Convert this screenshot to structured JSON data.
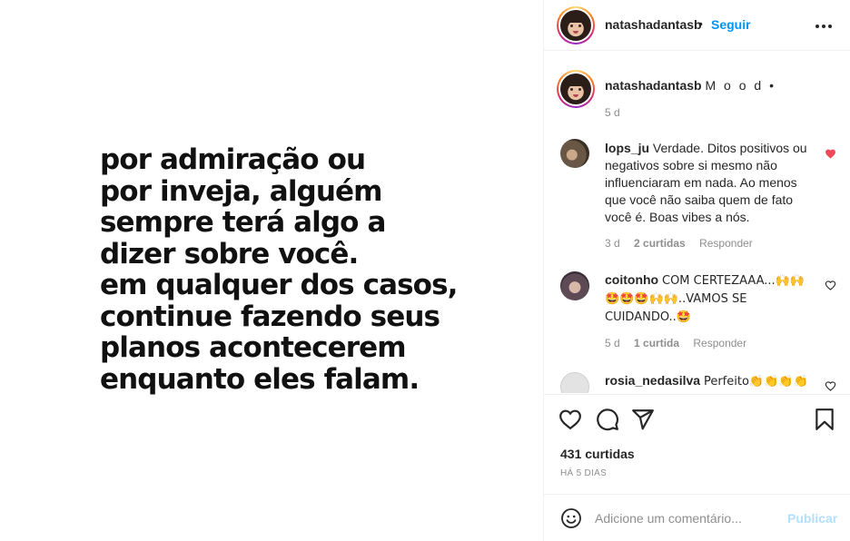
{
  "post": {
    "quote_lines": [
      "por admiração ou",
      "por inveja, alguém",
      "sempre terá algo a",
      "dizer sobre você.",
      "em qualquer dos casos,",
      "continue fazendo seus",
      "planos acontecerem",
      "enquanto eles falam."
    ]
  },
  "header": {
    "username": "natashadantasb",
    "separator": "•",
    "follow_label": "Seguir",
    "more_icon": "more-horizontal-icon"
  },
  "caption": {
    "username": "natashadantasb",
    "text": "M o o d •",
    "time": "5 d"
  },
  "comments": [
    {
      "username": "lops_ju",
      "text": "Verdade. Ditos positivos ou negativos sobre si mesmo não influenciaram em nada. Ao menos que você não saiba quem de fato você é. Boas vibes a nós.",
      "time": "3 d",
      "likes": "2 curtidas",
      "reply": "Responder",
      "liked": true
    },
    {
      "username": "coitonho",
      "text": "COM CERTEZAAA...🙌🙌 🤩🤩🤩🙌🙌..VAMOS SE CUIDANDO..🤩",
      "time": "5 d",
      "likes": "1 curtida",
      "reply": "Responder",
      "liked": false
    },
    {
      "username": "rosia_nedasilva",
      "text": "Perfeito👏👏👏👏",
      "liked": false
    }
  ],
  "actions": {
    "likes": "431 curtidas",
    "ago": "HÁ 5 DIAS"
  },
  "add_comment": {
    "placeholder": "Adicione um comentário...",
    "publish_label": "Publicar"
  },
  "colors": {
    "link_blue": "#0095f6",
    "publish_disabled": "#b2dffc",
    "heart_red": "#ed4956",
    "muted_gray": "#8e8e8e"
  }
}
